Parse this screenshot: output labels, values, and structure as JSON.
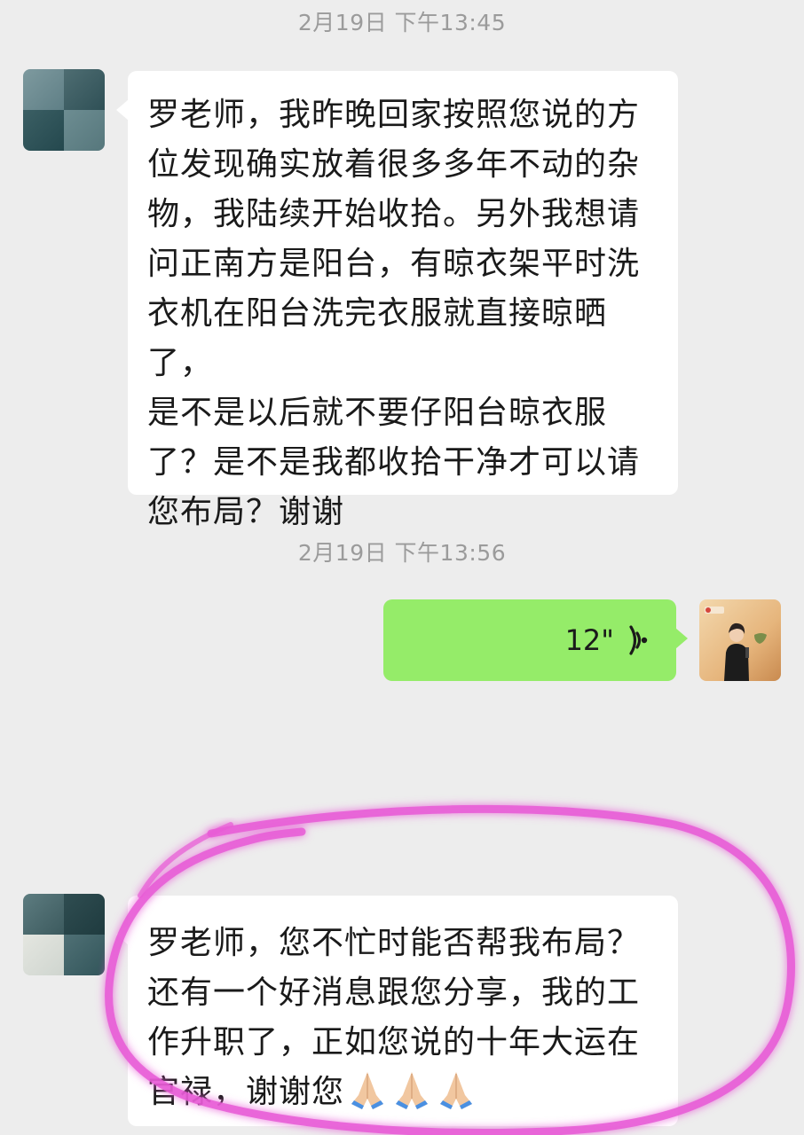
{
  "messages": [
    {
      "timestamp": "2月19日 下午13:45",
      "sender": "incoming",
      "text": "罗老师，我昨晚回家按照您说的方\n位发现确实放着很多多年不动的杂\n物，我陆续开始收拾。另外我想请\n问正南方是阳台，有晾衣架平时洗\n衣机在阳台洗完衣服就直接晾晒了，\n是不是以后就不要仔阳台晾衣服\n了？是不是我都收拾干净才可以请\n您布局？谢谢"
    },
    {
      "timestamp": "2月19日 下午13:56",
      "sender": "outgoing",
      "voice_duration": "12\""
    },
    {
      "sender": "incoming",
      "text": "罗老师，您不忙时能否帮我布局？\n还有一个好消息跟您分享，我的工\n作升职了，正如您说的十年大运在\n官禄，谢谢您",
      "emoji": [
        "pray",
        "pray",
        "pray"
      ]
    }
  ],
  "colors": {
    "background": "#ededed",
    "incoming_bubble": "#ffffff",
    "outgoing_bubble": "#95ec69",
    "timestamp": "#9b9b9b",
    "highlight": "#e85bd6"
  },
  "icons": {
    "voice": "voice-wave-icon",
    "emoji": "folded-hands-icon"
  }
}
